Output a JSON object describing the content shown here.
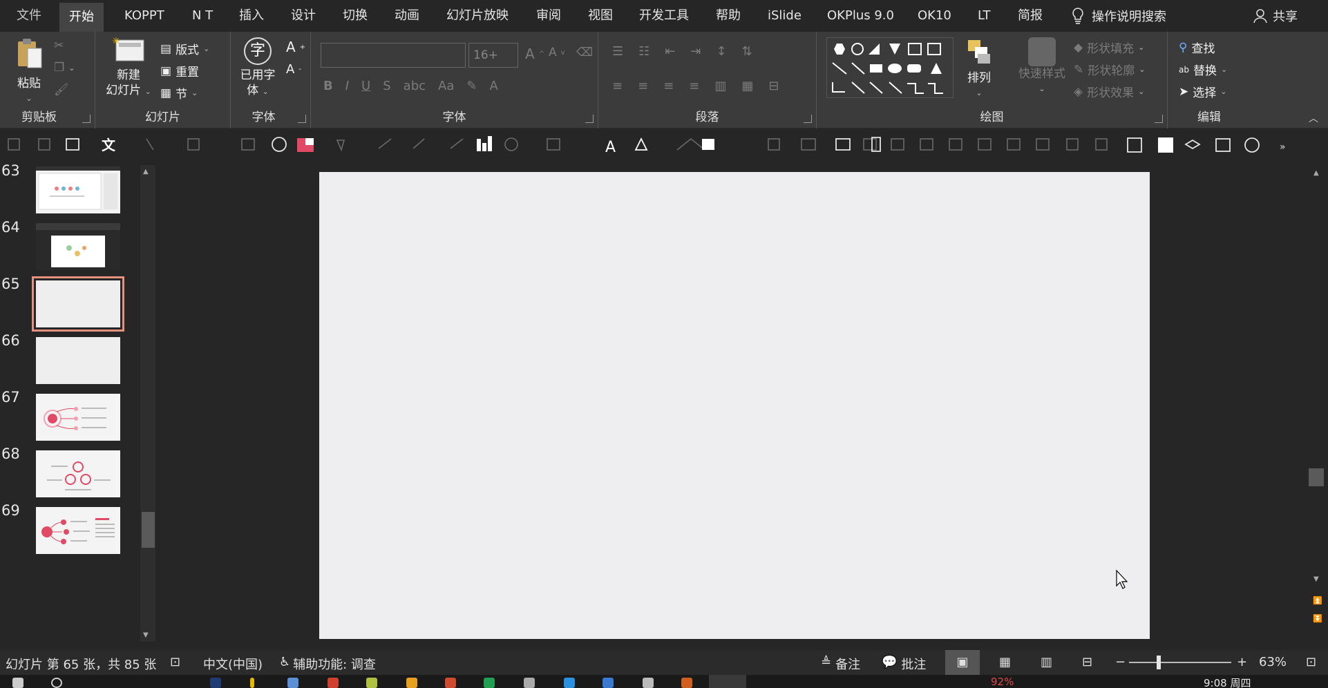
{
  "menu": {
    "tabs": [
      "文件",
      "开始",
      "KOPPT",
      "N T",
      "插入",
      "设计",
      "切换",
      "动画",
      "幻灯片放映",
      "审阅",
      "视图",
      "开发工具",
      "帮助",
      "iSlide",
      "OKPlus 9.0",
      "OK10",
      "LT",
      "简报"
    ],
    "search_label": "操作说明搜索",
    "share_label": "共享"
  },
  "ribbon": {
    "clipboard": {
      "paste": "粘贴",
      "group": "剪贴板"
    },
    "slides": {
      "new_line1": "新建",
      "new_line2": "幻灯片",
      "layout": "版式",
      "reset": "重置",
      "section": "节",
      "group": "幻灯片"
    },
    "usedfont": {
      "line1": "已用字",
      "line2": "体",
      "group": "字体",
      "icon_char": "字"
    },
    "font": {
      "name_value": "",
      "size_value": "16+",
      "group": "字体"
    },
    "paragraph": {
      "group": "段落"
    },
    "drawing": {
      "arrange": "排列",
      "quick_styles": "快速样式",
      "fill": "形状填充",
      "outline": "形状轮廓",
      "effects": "形状效果",
      "group": "绘图"
    },
    "editing": {
      "find": "查找",
      "replace": "替换",
      "select": "选择",
      "group": "编辑"
    }
  },
  "slides": [
    {
      "num": "63"
    },
    {
      "num": "64"
    },
    {
      "num": "65"
    },
    {
      "num": "66"
    },
    {
      "num": "67"
    },
    {
      "num": "68"
    },
    {
      "num": "69"
    }
  ],
  "status": {
    "slide_info": "幻灯片 第 65 张，共 85 张",
    "language": "中文(中国)",
    "accessibility": "辅助功能: 调查",
    "notes": "备注",
    "comments": "批注",
    "zoom": "63%"
  },
  "taskbar": {
    "battery": "92%",
    "clock": "9:08 周四"
  },
  "colors": {
    "accent_selected": "#e8907f",
    "ribbon_bg": "#3b3b3b",
    "thumb_pink": "#e04a64"
  }
}
